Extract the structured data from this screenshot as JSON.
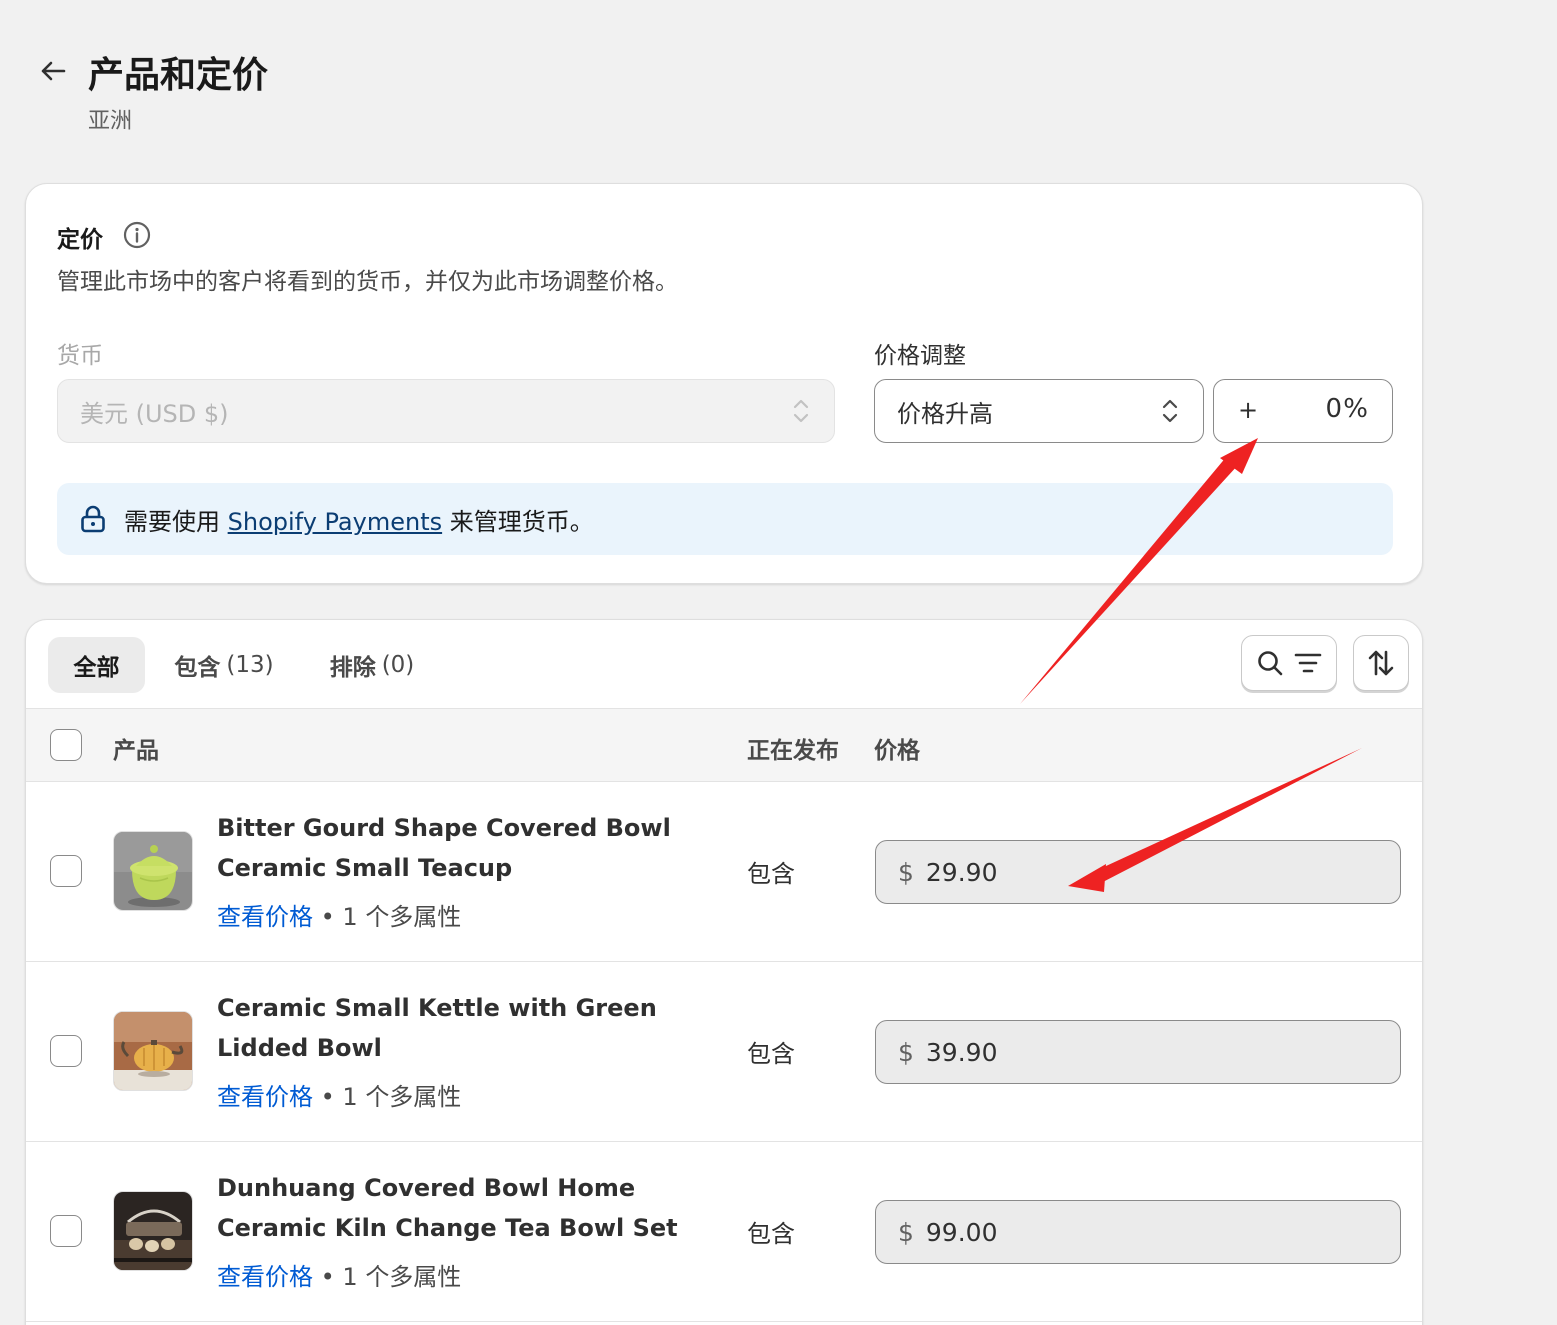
{
  "header": {
    "title": "产品和定价",
    "subtitle": "亚洲"
  },
  "pricing": {
    "title": "定价",
    "description": "管理此市场中的客户将看到的货币，并仅为此市场调整价格。",
    "currency_label": "货币",
    "currency_value": "美元 (USD $)",
    "adjust_label": "价格调整",
    "adjust_value": "价格升高",
    "percent_prefix": "+",
    "percent_value": "0",
    "percent_suffix": "%",
    "banner_before": "需要使用 ",
    "banner_link": "Shopify Payments",
    "banner_after": " 来管理货币。"
  },
  "tabs": [
    {
      "label": "全部",
      "count": ""
    },
    {
      "label": "包含",
      "count": "(13)"
    },
    {
      "label": "排除",
      "count": "(0)"
    }
  ],
  "table": {
    "col_product": "产品",
    "col_status": "正在发布",
    "col_price": "价格"
  },
  "products": [
    {
      "name": "Bitter Gourd Shape Covered Bowl Ceramic Small Teacup",
      "link": "查看价格",
      "meta": " • 1 个多属性",
      "status": "包含",
      "currency": "$",
      "price": "29.90"
    },
    {
      "name": "Ceramic Small Kettle with Green Lidded Bowl",
      "link": "查看价格",
      "meta": " • 1 个多属性",
      "status": "包含",
      "currency": "$",
      "price": "39.90"
    },
    {
      "name": "Dunhuang Covered Bowl Home Ceramic Kiln Change Tea Bowl Set",
      "link": "查看价格",
      "meta": " • 1 个多属性",
      "status": "包含",
      "currency": "$",
      "price": "99.00"
    }
  ],
  "colors": {
    "page_bg": "#f1f1f1",
    "link": "#005bd3",
    "banner_bg": "#eaf4fc",
    "annotation_arrow": "#ee2222"
  },
  "icons": [
    "back-arrow-icon",
    "info-icon",
    "chevron-updown-icon",
    "lock-icon",
    "search-icon",
    "filter-icon",
    "sort-icon"
  ]
}
